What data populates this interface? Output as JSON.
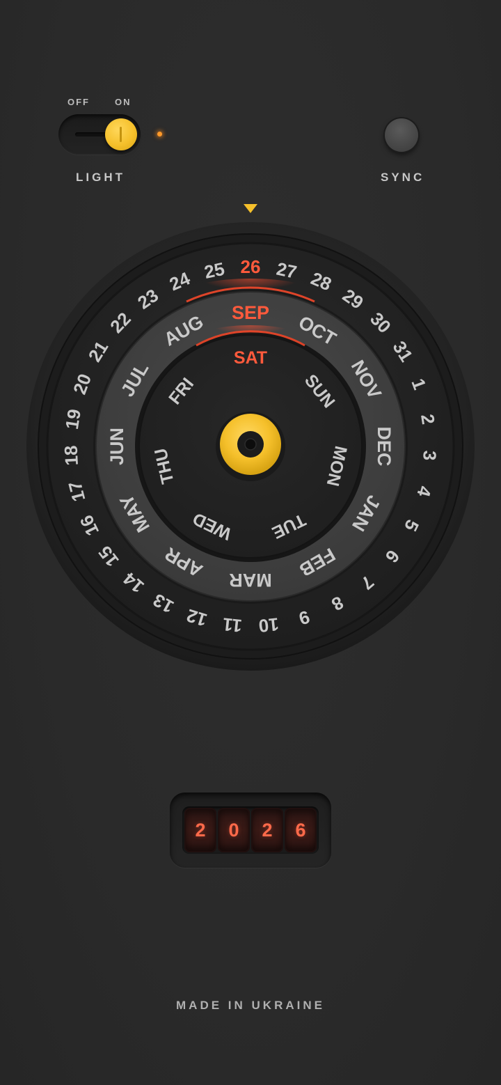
{
  "light": {
    "off_label": "OFF",
    "on_label": "ON",
    "label": "LIGHT",
    "state": "on"
  },
  "sync": {
    "label": "SYNC"
  },
  "dial": {
    "days": [
      "1",
      "2",
      "3",
      "4",
      "5",
      "6",
      "7",
      "8",
      "9",
      "10",
      "11",
      "12",
      "13",
      "14",
      "15",
      "16",
      "17",
      "18",
      "19",
      "20",
      "21",
      "22",
      "23",
      "24",
      "25",
      "26",
      "27",
      "28",
      "29",
      "30",
      "31"
    ],
    "months": [
      "JAN",
      "FEB",
      "MAR",
      "APR",
      "MAY",
      "JUN",
      "JUL",
      "AUG",
      "SEP",
      "OCT",
      "NOV",
      "DEC"
    ],
    "weekdays": [
      "MON",
      "TUE",
      "WED",
      "THU",
      "FRI",
      "SAT",
      "SUN"
    ],
    "selected_day": "26",
    "selected_month": "SEP",
    "selected_weekday": "SAT",
    "accent_color": "#ff5a3c",
    "text_color": "#c9c9c9",
    "knob_color": "#f5c02b"
  },
  "year": {
    "digits": [
      "2",
      "0",
      "2",
      "6"
    ]
  },
  "footer": {
    "text": "MADE IN UKRAINE"
  }
}
